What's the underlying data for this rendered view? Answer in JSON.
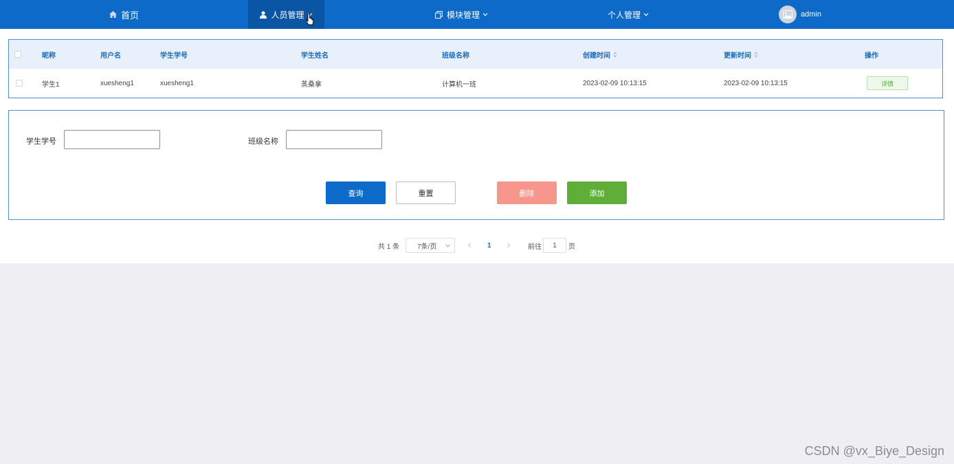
{
  "nav": {
    "home": "首页",
    "personnel": "人员管理",
    "modules": "模块管理",
    "personal": "个人管理",
    "user": "admin",
    "icons": {
      "home": "home-icon",
      "personnel": "user-icon",
      "modules": "copy-icon",
      "caret": "chevron-down-icon",
      "avatar": "image-icon"
    }
  },
  "table": {
    "columns": [
      "昵称",
      "用户名",
      "学生学号",
      "学生姓名",
      "班级名称",
      "创建时间",
      "更新时间",
      "操作"
    ],
    "rows": [
      {
        "nickname": "学生1",
        "username": "xuesheng1",
        "student_no": "xuesheng1",
        "student_name": "蒸桑拿",
        "class_name": "计算机一班",
        "created": "2023-02-09 10:13:15",
        "updated": "2023-02-09 10:13:15",
        "action": "详情"
      }
    ]
  },
  "form": {
    "student_no_label": "学生学号",
    "student_no_value": "",
    "class_name_label": "班级名称",
    "class_name_value": "",
    "query": "查询",
    "reset": "重置",
    "delete": "删除",
    "add": "添加"
  },
  "pager": {
    "total": "共 1 条",
    "page_size": "7条/页",
    "current": "1",
    "goto_prefix": "前往",
    "goto_value": "1",
    "goto_suffix": "页"
  },
  "colors": {
    "topbar": "#0d6ac8",
    "active_nav": "#0a55a4",
    "query": "#0d6ac8",
    "delete": "#f7968d",
    "add": "#5fae38"
  },
  "watermark": "CSDN @vx_Biye_Design"
}
